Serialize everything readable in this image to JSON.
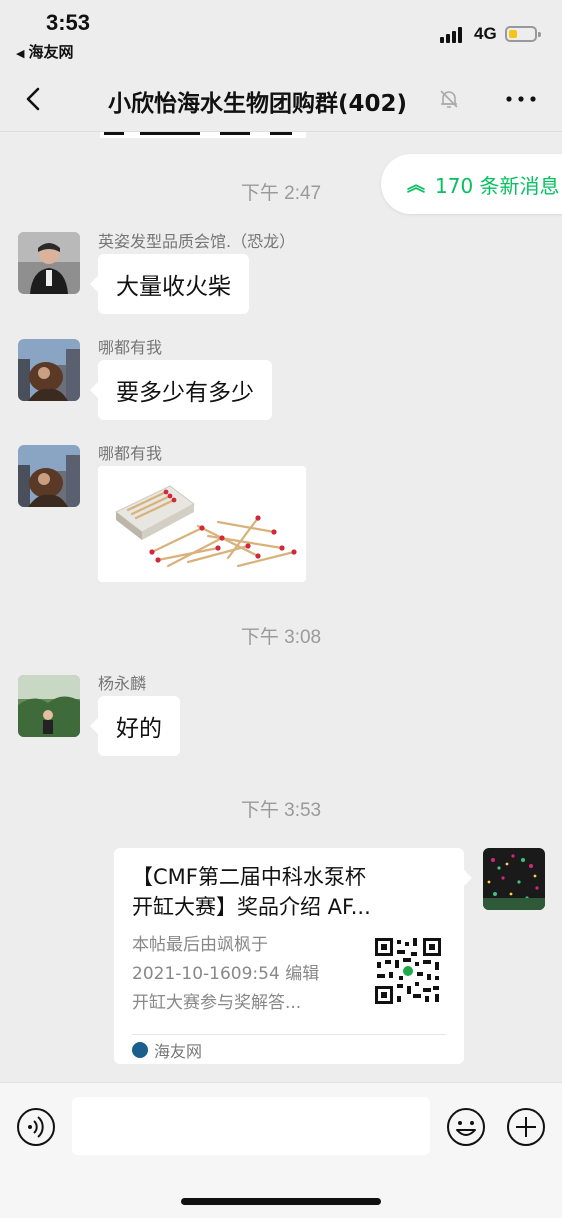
{
  "status_bar": {
    "time": "3:53",
    "back_app": "海友网",
    "network": "4G"
  },
  "nav": {
    "title": "小欣怡海水生物团购群(402)"
  },
  "new_messages": {
    "label": "170 条新消息"
  },
  "messages": [
    {
      "type": "timestamp",
      "text": "下午 2:47"
    },
    {
      "type": "text",
      "sender": "英姿发型品质会馆.（恐龙）",
      "text": "大量收火柴"
    },
    {
      "type": "text",
      "sender": "哪都有我",
      "text": "要多少有多少"
    },
    {
      "type": "image",
      "sender": "哪都有我",
      "image": "matches-photo"
    },
    {
      "type": "timestamp",
      "text": "下午 3:08"
    },
    {
      "type": "text",
      "sender": "杨永麟",
      "text": "好的"
    },
    {
      "type": "timestamp",
      "text": "下午 3:53"
    },
    {
      "type": "link-card",
      "title_lines": [
        "【CMF第二届中科水泵杯",
        "开缸大赛】奖品介绍 AF..."
      ],
      "desc_lines": [
        "本帖最后由飒枫于",
        "2021-10-1609:54 编辑",
        "开缸大赛参与奖解答..."
      ],
      "source": "海友网"
    }
  ],
  "colors": {
    "accent": "#07c160",
    "background": "#ededed",
    "bubble": "#ffffff"
  }
}
